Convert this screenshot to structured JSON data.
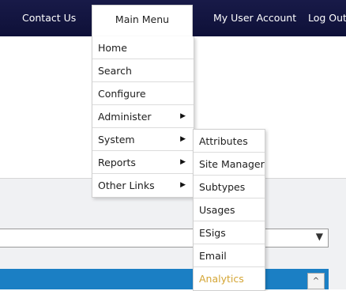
{
  "topnav": {
    "contact_us": "Contact Us",
    "main_menu": "Main Menu",
    "my_user_account": "My User Account",
    "log_out": "Log Out"
  },
  "main_menu": {
    "items": [
      {
        "label": "Home",
        "has_submenu": false
      },
      {
        "label": "Search",
        "has_submenu": false
      },
      {
        "label": "Configure",
        "has_submenu": false
      },
      {
        "label": "Administer",
        "has_submenu": true
      },
      {
        "label": "System",
        "has_submenu": true
      },
      {
        "label": "Reports",
        "has_submenu": true
      },
      {
        "label": "Other Links",
        "has_submenu": true
      }
    ],
    "arrow_icon": "▶"
  },
  "system_submenu": {
    "items": [
      {
        "label": "Attributes"
      },
      {
        "label": "Site Manager"
      },
      {
        "label": "Subtypes"
      },
      {
        "label": "Usages"
      },
      {
        "label": "ESigs"
      },
      {
        "label": "Email"
      },
      {
        "label": "Analytics",
        "highlighted": true
      }
    ]
  },
  "page": {
    "dropdown_arrow": "▼",
    "scroll_up_arrow": "^"
  },
  "colors": {
    "nav_background": "#14163f",
    "accent_blue": "#1b7fc4",
    "highlight_text": "#d4a534"
  }
}
